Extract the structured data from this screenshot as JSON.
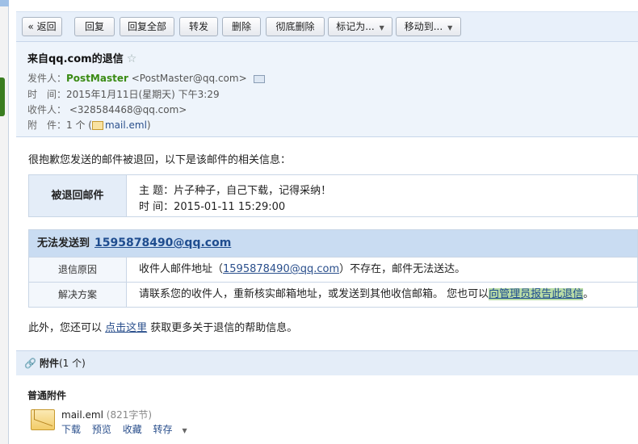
{
  "toolbar": {
    "back": "« 返回",
    "reply": "回复",
    "reply_all": "回复全部",
    "forward": "转发",
    "delete": "删除",
    "delete_permanently": "彻底删除",
    "mark_as": "标记为...",
    "move_to": "移动到..."
  },
  "header": {
    "subject": "来自qq.com的退信",
    "star": "☆",
    "sender_label": "发件人：",
    "sender_name": "PostMaster",
    "sender_email": "<PostMaster@qq.com>",
    "time_label": "时　间：",
    "time_value": "2015年1月11日(星期天) 下午3:29",
    "recipient_label": "收件人：",
    "recipient_value": "<328584468@qq.com>",
    "attachment_label": "附　件：",
    "attachment_count": "1 个 (",
    "attachment_name": "mail.eml",
    "attachment_close": ")"
  },
  "body": {
    "intro": "很抱歉您发送的邮件被退回，以下是该邮件的相关信息：",
    "bounced_label": "被退回邮件",
    "bounced_subject": "主 题：片子种子，自己下载，记得采纳！",
    "bounced_time": "时 间：2015-01-11 15:29:00",
    "undeliverable_label": "无法发送到",
    "undeliverable_addr": "1595878490@qq.com",
    "reason_label": "退信原因",
    "reason_pre": "收件人邮件地址（",
    "reason_link": "1595878490@qq.com",
    "reason_post": "）不存在，邮件无法送达。",
    "solution_label": "解决方案",
    "solution_text": "请联系您的收件人，重新核实邮箱地址，或发送到其他收信邮箱。 您也可以",
    "solution_link": "向管理员报告此退信",
    "solution_end": "。",
    "help_pre": "此外，您还可以 ",
    "help_link": "点击这里",
    "help_post": " 获取更多关于退信的帮助信息。"
  },
  "attachments": {
    "title": "附件",
    "count": "(1 个)",
    "section_label": "普通附件",
    "file_name": "mail.eml",
    "file_size": "(821字节)",
    "actions": [
      "下载",
      "预览",
      "收藏",
      "转存"
    ]
  }
}
